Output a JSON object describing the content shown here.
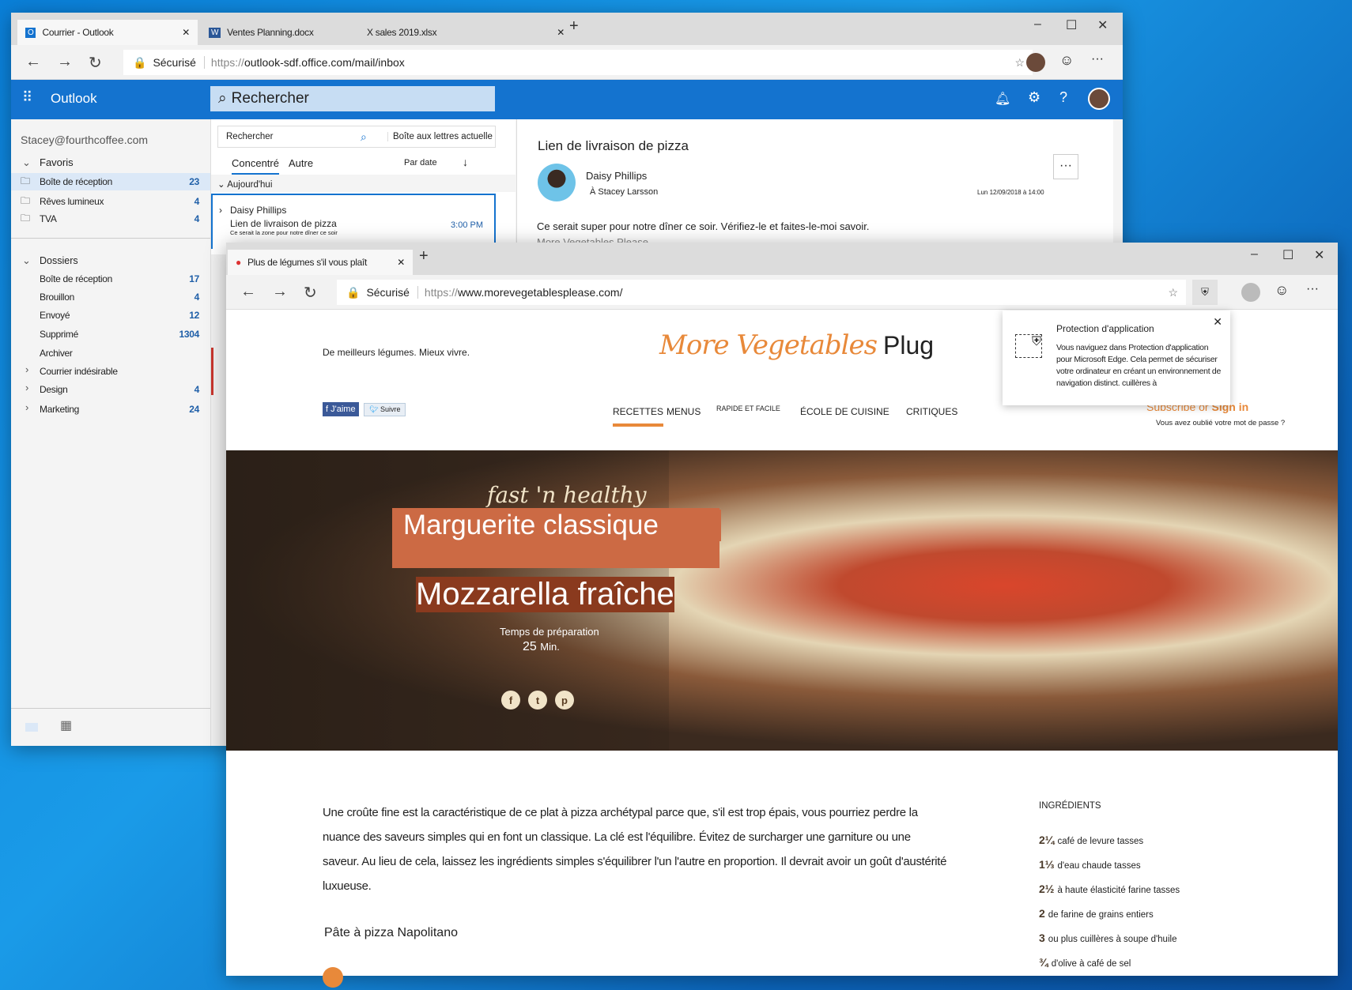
{
  "outlook_window": {
    "tabs": [
      {
        "label": "Courrier - Outlook",
        "icon": "outlook-icon",
        "active": true
      },
      {
        "label": "Ventes Planning.docx",
        "icon": "word-icon"
      },
      {
        "label": "X sales 2019.xlsx",
        "icon": "excel-icon"
      }
    ],
    "secure_label": "Sécurisé",
    "url_scheme": "https://",
    "url_rest": "outlook-sdf.office.com/mail/inbox",
    "app_name": "Outlook",
    "search_placeholder": "Rechercher",
    "accent": "#1473cf",
    "account": "Stacey@fourthcoffee.com",
    "favorites": {
      "label": "Favoris",
      "items": [
        {
          "label": "Boîte de réception",
          "count": "23",
          "selected": true
        },
        {
          "label": "Rêves lumineux",
          "count": "4"
        },
        {
          "label": "TVA",
          "count": "4"
        }
      ]
    },
    "folders": {
      "label": "Dossiers",
      "items": [
        {
          "label": "Boîte de réception",
          "count": "17"
        },
        {
          "label": "Brouillon",
          "count": "4"
        },
        {
          "label": "Envoyé",
          "count": "12"
        },
        {
          "label": "Supprimé",
          "count": "1304"
        },
        {
          "label": "Archiver",
          "count": ""
        }
      ]
    },
    "groups": [
      {
        "label": "Courrier indésirable",
        "count": ""
      },
      {
        "label": "Design",
        "count": "4"
      },
      {
        "label": "Marketing",
        "count": "24"
      }
    ],
    "list": {
      "search_placeholder": "Rechercher",
      "scope": "Boîte aux lettres actuelle",
      "tab_focused": "Concentré",
      "tab_other": "Autre",
      "sort": "Par date",
      "group_today": "Aujourd'hui",
      "message": {
        "sender": "Daisy Phillips",
        "subject": "Lien de livraison de pizza",
        "preview": "Ce serait la zone pour notre dîner ce soir",
        "time": "3:00 PM"
      }
    },
    "reading": {
      "subject": "Lien de livraison de pizza",
      "sender": "Daisy Phillips",
      "to": "À Stacey Larsson",
      "date": "Lun 12/09/2018 à 14:00",
      "body": "Ce serait super pour notre dîner ce soir. Vérifiez-le et faites-le-moi savoir.",
      "body2": "More Vegetables Please",
      "more": "···"
    }
  },
  "edge_window": {
    "tab_label": "Plus de légumes s'il vous plaît",
    "secure_label": "Sécurisé",
    "url_scheme": "https://",
    "url_rest": "www.morevegetablesplease.com/",
    "popup": {
      "title": "Protection d'application",
      "body": "Vous naviguez dans Protection d'application pour Microsoft Edge. Cela permet de sécuriser votre ordinateur en créant un environnement de navigation distinct. cuillères à",
      "close": "✕"
    },
    "site": {
      "tagline": "De meilleurs légumes. Mieux vivre.",
      "logo_script": "More Vegetables",
      "logo_plain": "Plug",
      "fb_like": "J'aime",
      "tw_follow": "Suivre",
      "nav": [
        "RECETTES",
        "MENUS",
        "RAPIDE ET FACILE",
        "ÉCOLE DE CUISINE",
        "CRITIQUES"
      ],
      "subscribe": "Subscribe or",
      "sign_in": "Sign in",
      "forgot": "Vous avez oublié votre mot de passe ?",
      "hero": {
        "script": "fast 'n healthy",
        "title1": "Marguerite classique",
        "title2": "Mozzarella fraîche",
        "prep_label": "Temps de préparation",
        "prep_value": "25",
        "prep_unit": "Min."
      },
      "intro": "Une croûte fine est la caractéristique de ce plat à pizza archétypal parce que, s'il est trop épais, vous pourriez perdre la nuance des saveurs simples qui en font un classique. La clé est l'équilibre. Évitez de surcharger une garniture ou une saveur. Au lieu de cela, laissez les ingrédients simples s'équilibrer l'un l'autre en proportion. Il devrait avoir un goût d'austérité luxueuse.",
      "dough_title": "Pâte à pizza Napolitano",
      "ingredients_title": "INGRÉDIENTS",
      "ingredients": [
        {
          "qty": "2¼",
          "text": "café de levure tasses"
        },
        {
          "qty": "1⅓",
          "text": "d'eau chaude tasses"
        },
        {
          "qty": "2½",
          "text": "à haute élasticité farine tasses"
        },
        {
          "qty": "2",
          "text": "de farine de grains entiers"
        },
        {
          "qty": "3",
          "text": "ou plus cuillères à soupe d'huile"
        },
        {
          "qty": "¾",
          "text": "d'olive à café de sel"
        }
      ],
      "brand_color": "#e8893a",
      "hero_band": "#cc6a44"
    }
  }
}
